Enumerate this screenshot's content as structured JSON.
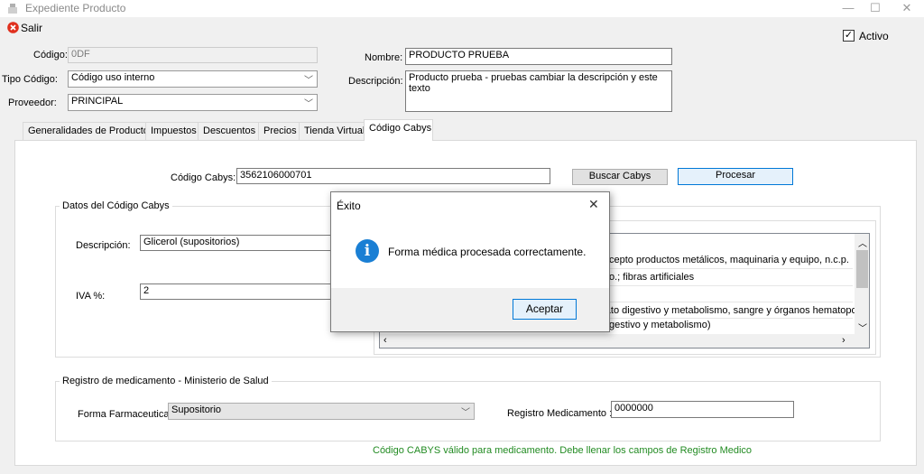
{
  "window": {
    "title": "Expediente Producto",
    "minimize": "—",
    "maximize": "☐",
    "close": "✕"
  },
  "toolbar": {
    "exit_label": "Salir",
    "exit_icon": "x-circle-icon"
  },
  "header": {
    "active_label": "Activo",
    "active_checked": true,
    "codigo_label": "Código:",
    "codigo_value": "0DF",
    "tipo_codigo_label": "Tipo Código:",
    "tipo_codigo_value": "Código uso interno",
    "proveedor_label": "Proveedor:",
    "proveedor_value": "PRINCIPAL",
    "nombre_label": "Nombre:",
    "nombre_value": "PRODUCTO PRUEBA",
    "descripcion_label": "Descripción:",
    "descripcion_value": "Producto prueba - pruebas cambiar la descripción y este texto"
  },
  "tabs": [
    {
      "label": "Generalidades de Producto"
    },
    {
      "label": "Impuestos"
    },
    {
      "label": "Descuentos"
    },
    {
      "label": "Precios"
    },
    {
      "label": "Tienda Virtual"
    },
    {
      "label": "Código Cabys"
    }
  ],
  "cabys": {
    "codigo_label": "Código Cabys:",
    "codigo_value": "3562106000701",
    "buscar_label": "Buscar Cabys",
    "procesar_label": "Procesar",
    "datos_group_label": "Datos del Código Cabys",
    "descripcion_label": "Descripción:",
    "descripcion_value": "Glicerol (supositorios)",
    "iva_label": "IVA %:",
    "iva_value": "2",
    "hierarchy_rows": [
      "cepto productos metálicos, maquinaria y equipo, n.c.p.",
      "o.; fibras artificiales",
      "",
      "arato digestivo y metabolismo, sangre y órganos hematopoyé",
      "gestivo y metabolismo)"
    ]
  },
  "registro": {
    "group_label": "Registro de medicamento - Ministerio de Salud",
    "forma_label": "Forma Farmaceutica:",
    "forma_value": "Supositorio",
    "registro_label": "Registro Medicamento :",
    "registro_value": "0000000",
    "status_message": "Código CABYS válido para medicamento. Debe llenar los campos de Registro Medico",
    "status_color": "#228b22"
  },
  "dialog": {
    "title": "Éxito",
    "message": "Forma médica procesada correctamente.",
    "ok_label": "Aceptar",
    "close_glyph": "✕",
    "icon": "info-icon",
    "icon_glyph": "i"
  }
}
